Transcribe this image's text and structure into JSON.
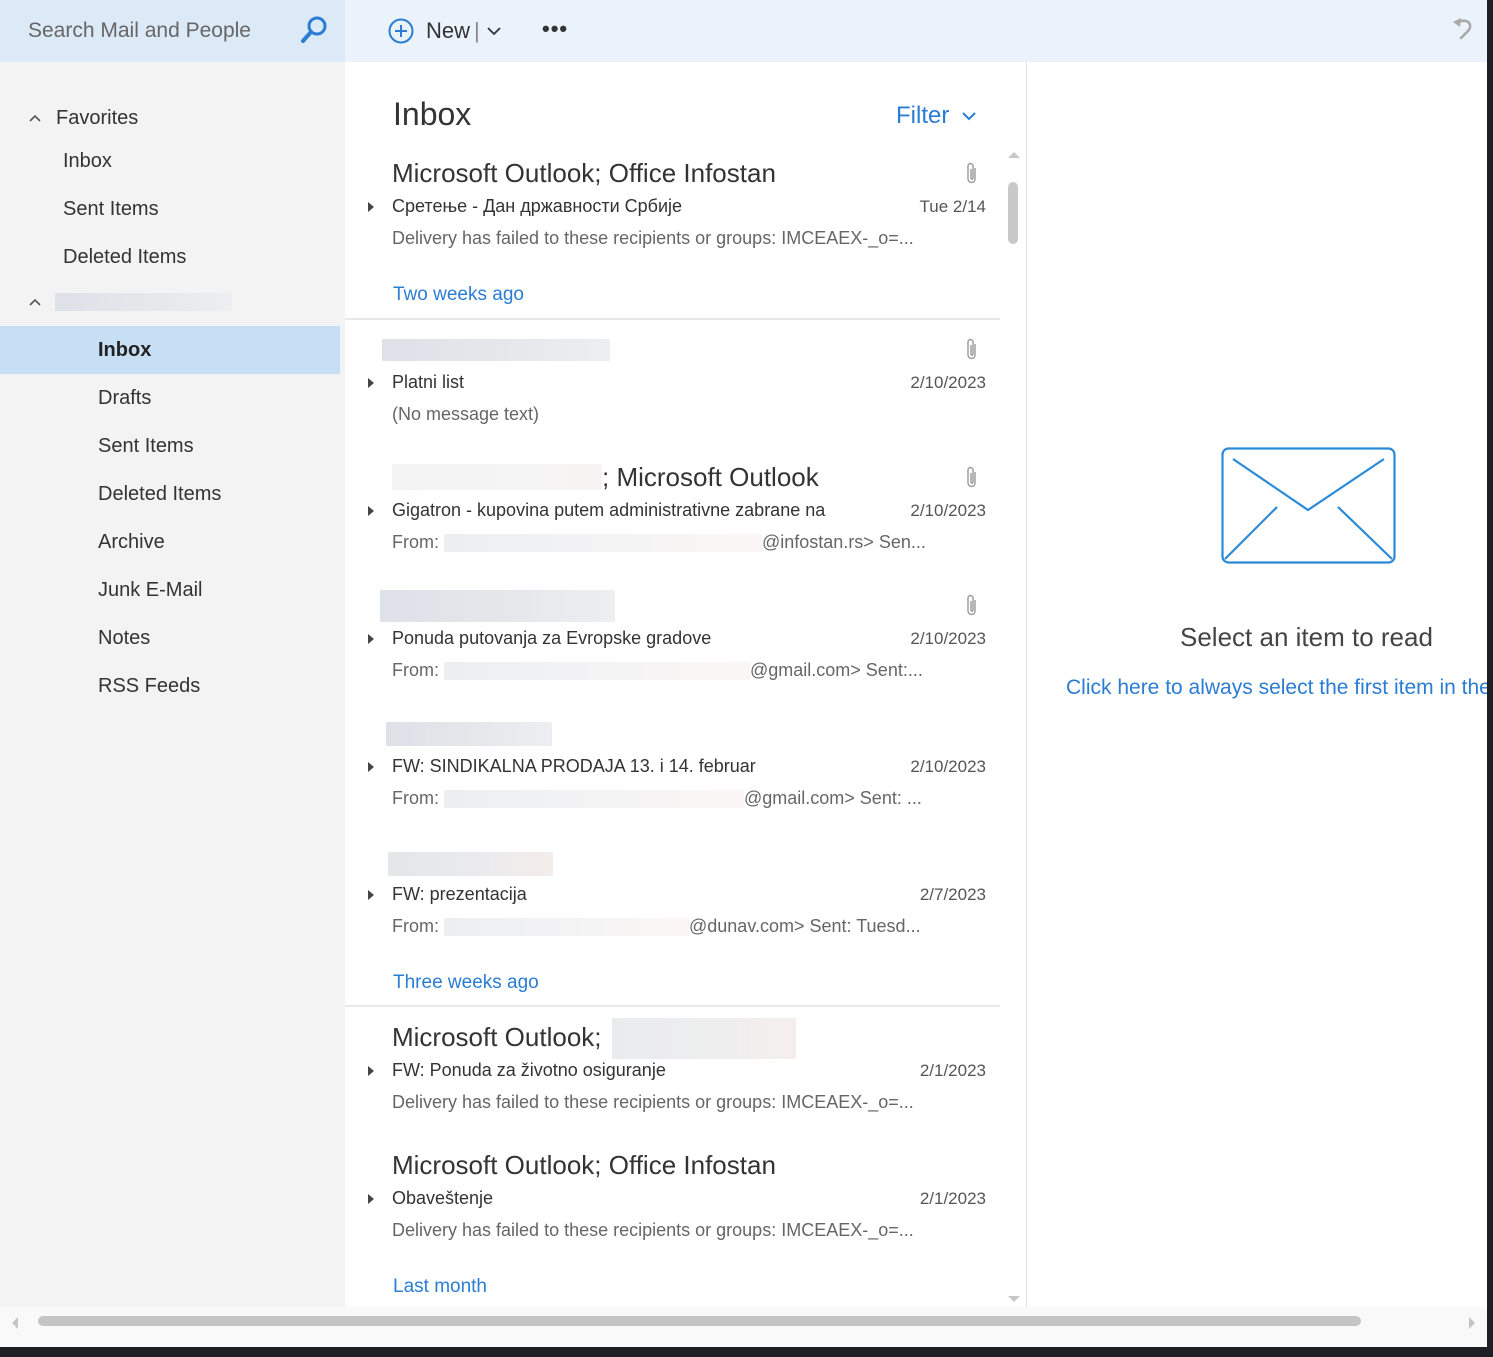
{
  "topbar": {
    "search_placeholder": "Search Mail and People",
    "new_label": "New",
    "new_separator": "|",
    "more_label": "•••"
  },
  "sidebar": {
    "favorites_label": "Favorites",
    "favorites": [
      {
        "label": "Inbox"
      },
      {
        "label": "Sent Items"
      },
      {
        "label": "Deleted Items"
      }
    ],
    "account_name_redacted": true,
    "folders": [
      {
        "label": "Inbox",
        "selected": true
      },
      {
        "label": "Drafts"
      },
      {
        "label": "Sent Items"
      },
      {
        "label": "Deleted Items"
      },
      {
        "label": "Archive"
      },
      {
        "label": "Junk E-Mail"
      },
      {
        "label": "Notes"
      },
      {
        "label": "RSS Feeds"
      }
    ]
  },
  "list": {
    "title": "Inbox",
    "filter_label": "Filter",
    "groups": [
      {
        "label": "Two weeks ago"
      },
      {
        "label": "Three weeks ago"
      },
      {
        "label": "Last month"
      }
    ],
    "messages": [
      {
        "sender": "Microsoft Outlook; Office Infostan",
        "subject": "Сретење - Дан државности Србије",
        "date": "Tue 2/14",
        "preview": "Delivery has failed to these recipients or groups: IMCEAEX-_o=...",
        "attachment": true
      },
      {
        "sender": "",
        "subject": "Platni list",
        "date": "2/10/2023",
        "preview": "(No message text)",
        "attachment": true
      },
      {
        "sender": "; Microsoft Outlook",
        "subject": "Gigatron - kupovina putem administrativne zabrane na",
        "date": "2/10/2023",
        "preview_prefix": "From: ",
        "preview": "@infostan.rs> Sen...",
        "attachment": true
      },
      {
        "sender": "",
        "subject": "Ponuda putovanja za Evropske gradove",
        "date": "2/10/2023",
        "preview_prefix": "From: ",
        "preview": "@gmail.com> Sent:...",
        "attachment": true
      },
      {
        "sender": "",
        "subject": "FW: SINDIKALNA PRODAJA 13. i 14. februar",
        "date": "2/10/2023",
        "preview_prefix": "From: ",
        "preview": "@gmail.com> Sent: ...",
        "attachment": false
      },
      {
        "sender": "",
        "subject": "FW: prezentacija",
        "date": "2/7/2023",
        "preview_prefix": "From: ",
        "preview": "@dunav.com> Sent: Tuesd...",
        "attachment": false
      },
      {
        "sender": "Microsoft Outlook;",
        "subject": "FW: Ponuda za životno osiguranje",
        "date": "2/1/2023",
        "preview": "Delivery has failed to these recipients or groups: IMCEAEX-_o=...",
        "attachment": false
      },
      {
        "sender": "Microsoft Outlook; Office Infostan",
        "subject": "Obaveštenje",
        "date": "2/1/2023",
        "preview": "Delivery has failed to these recipients or groups: IMCEAEX-_o=...",
        "attachment": false
      }
    ]
  },
  "reading": {
    "empty_title": "Select an item to read",
    "first_item_link": "Click here to always select the first item in the list"
  },
  "colors": {
    "accent": "#2b7cd3",
    "selected_bg": "#c7dff4",
    "topbar_bg": "#eaf3fc",
    "search_bg": "#dce9f6",
    "sidebar_bg": "#f3f3f3"
  }
}
